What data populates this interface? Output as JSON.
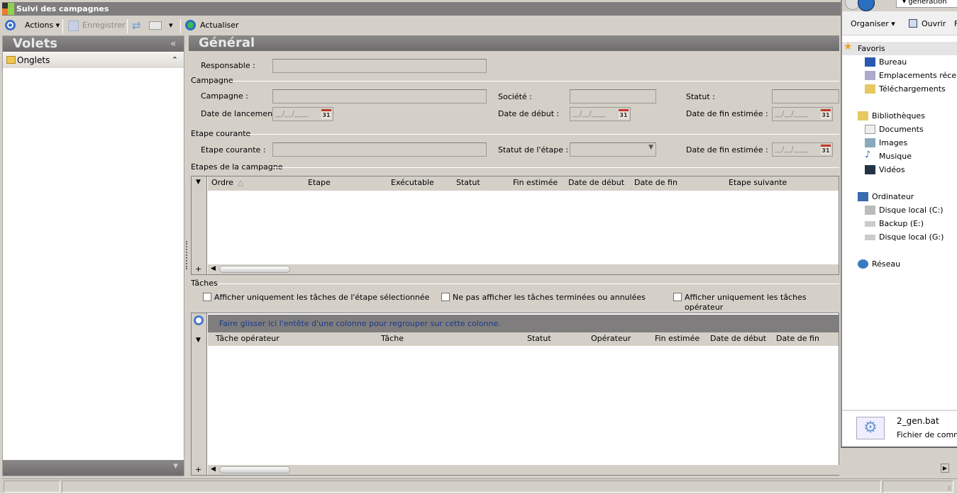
{
  "window": {
    "title": "Suivi des campagnes"
  },
  "toolbar": {
    "actions": "Actions",
    "save": "Enregistrer",
    "refresh": "Actualiser"
  },
  "left_panel": {
    "title": "Volets",
    "collapse": "«",
    "section": "Onglets",
    "section_toggle": "⌃"
  },
  "main": {
    "title": "Général",
    "responsable_label": "Responsable :",
    "campagne_group": "Campagne",
    "campagne_label": "Campagne :",
    "societe_label": "Société :",
    "statut_label": "Statut :",
    "date_lancement_label": "Date de lancement :",
    "date_debut_label": "Date de début :",
    "date_fin_label": "Date de fin estimée :",
    "etape_group": "Etape courante",
    "etape_label": "Etape courante :",
    "statut_etape_label": "Statut de l'étape :",
    "date_fin_etape_label": "Date de fin estimée :",
    "date_mask": "__/__/____",
    "cal_day": "31",
    "etapes_group": "Etapes de la campagne",
    "etapes_columns": [
      "Ordre",
      "Etape",
      "Exécutable",
      "Statut",
      "Fin estimée",
      "Date de début",
      "Date de fin",
      "Etape suivante"
    ],
    "taches_group": "Tâches",
    "checkboxes": [
      "Afficher uniquement les tâches de l'étape sélectionnée",
      "Ne pas afficher les tâches terminées ou annulées",
      "Afficher uniquement les tâches opérateur"
    ],
    "group_hint": "Faire glisser ici l'entête d'une colonne pour regrouper sur cette colonne.",
    "taches_columns": [
      "Tâche opérateur",
      "Tâche",
      "Statut",
      "Opérateur",
      "Fin estimée",
      "Date de début",
      "Date de fin"
    ]
  },
  "explorer": {
    "address": "génération",
    "organiser": "Organiser",
    "ouvrir": "Ouvrir",
    "more": "F",
    "favoris": "Favoris",
    "fav_items": [
      "Bureau",
      "Emplacements récents",
      "Téléchargements"
    ],
    "bibliotheques": "Bibliothèques",
    "lib_items": [
      "Documents",
      "Images",
      "Musique",
      "Vidéos"
    ],
    "ordinateur": "Ordinateur",
    "drives": [
      "Disque local (C:)",
      "Backup (E:)",
      "Disque local (G:)"
    ],
    "reseau": "Réseau",
    "file_name": "2_gen.bat",
    "file_type": "Fichier de commandes"
  }
}
